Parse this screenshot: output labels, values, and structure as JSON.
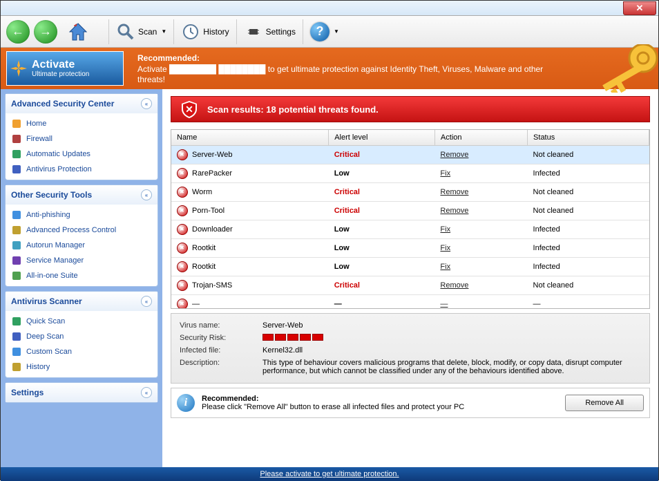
{
  "toolbar": {
    "scan": "Scan",
    "history": "History",
    "settings": "Settings"
  },
  "orange": {
    "activate_title": "Activate",
    "activate_sub": "Ultimate protection",
    "rec_label": "Recommended:",
    "rec_text": "Activate ████████ ████████ to get ultimate protection against Identity Theft, Viruses, Malware and other threats!"
  },
  "sidebar": {
    "panel1": {
      "title": "Advanced Security Center",
      "items": [
        "Home",
        "Firewall",
        "Automatic Updates",
        "Antivirus Protection"
      ]
    },
    "panel2": {
      "title": "Other Security Tools",
      "items": [
        "Anti-phishing",
        "Advanced Process Control",
        "Autorun Manager",
        "Service Manager",
        "All-in-one Suite"
      ]
    },
    "panel3": {
      "title": "Antivirus Scanner",
      "items": [
        "Quick Scan",
        "Deep Scan",
        "Custom Scan",
        "History"
      ]
    },
    "panel4": {
      "title": "Settings"
    }
  },
  "alert": "Scan results: 18 potential threats found.",
  "table": {
    "headers": [
      "Name",
      "Alert level",
      "Action",
      "Status"
    ],
    "rows": [
      {
        "name": "Server-Web",
        "level": "Critical",
        "action": "Remove",
        "status": "Not cleaned",
        "sel": true
      },
      {
        "name": "RarePacker",
        "level": "Low",
        "action": "Fix",
        "status": "Infected"
      },
      {
        "name": "Worm",
        "level": "Critical",
        "action": "Remove",
        "status": "Not cleaned"
      },
      {
        "name": "Porn-Tool",
        "level": "Critical",
        "action": "Remove",
        "status": "Not cleaned"
      },
      {
        "name": "Downloader",
        "level": "Low",
        "action": "Fix",
        "status": "Infected"
      },
      {
        "name": "Rootkit",
        "level": "Low",
        "action": "Fix",
        "status": "Infected"
      },
      {
        "name": "Rootkit",
        "level": "Low",
        "action": "Fix",
        "status": "Infected"
      },
      {
        "name": "Trojan-SMS",
        "level": "Critical",
        "action": "Remove",
        "status": "Not cleaned"
      },
      {
        "name": "—",
        "level": "—",
        "action": "—",
        "status": "—"
      }
    ]
  },
  "details": {
    "virus_name_lbl": "Virus name:",
    "virus_name": "Server-Web",
    "risk_lbl": "Security Risk:",
    "file_lbl": "Infected file:",
    "file": "Kernel32.dll",
    "desc_lbl": "Description:",
    "desc": "This type of behaviour covers malicious programs that delete, block, modify, or copy data, disrupt computer performance, but which cannot be classified under any of the behaviours identified above."
  },
  "bottom": {
    "rec_label": "Recommended:",
    "rec_text": "Please click \"Remove All\" button to erase all infected files and protect your PC",
    "btn": "Remove All"
  },
  "footer": "Please activate to get ultimate protection."
}
